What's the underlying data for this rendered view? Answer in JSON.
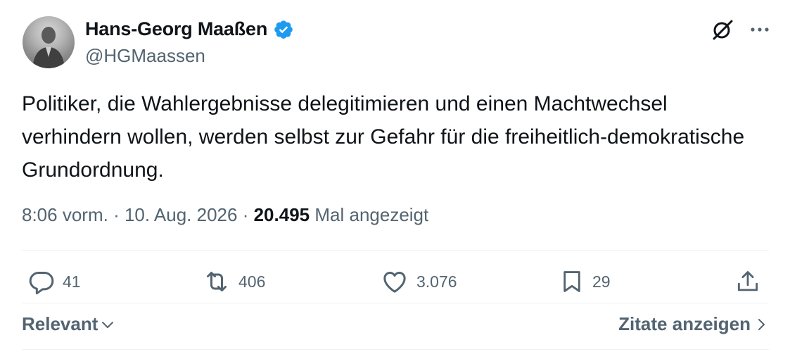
{
  "author": {
    "display_name": "Hans-Georg Maaßen",
    "handle": "@HGMaassen",
    "verified_color": "#1d9bf0"
  },
  "tweet": {
    "text": "Politiker, die Wahlergebnisse delegitimieren und einen Machtwechsel verhindern wollen, werden selbst zur Gefahr für die freiheitlich-demokratische Grundordnung."
  },
  "meta": {
    "time": "8:06 vorm.",
    "separator": "·",
    "date": "10. Aug. 2026",
    "views_count": "20.495",
    "views_label": "Mal angezeigt"
  },
  "actions": {
    "replies": "41",
    "reposts": "406",
    "likes": "3.076",
    "bookmarks": "29"
  },
  "footer": {
    "sort_label": "Relevant",
    "quotes_label": "Zitate anzeigen"
  },
  "colors": {
    "text": "#0f1419",
    "secondary": "#536471",
    "divider": "#eff3f4"
  }
}
